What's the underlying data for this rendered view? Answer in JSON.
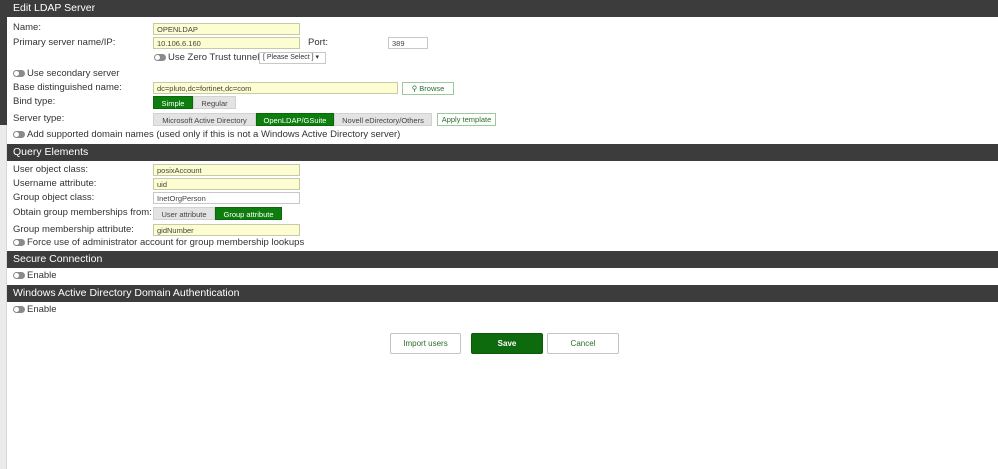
{
  "sections": {
    "edit": "Edit LDAP Server",
    "query": "Query Elements",
    "secure": "Secure Connection",
    "windows": "Windows Active Directory Domain Authentication"
  },
  "name": {
    "label": "Name:",
    "value": "OPENLDAP"
  },
  "primary_server": {
    "label": "Primary server name/IP:",
    "value": "10.106.6.160"
  },
  "port": {
    "label": "Port:",
    "value": "389"
  },
  "zero_trust": {
    "label": "Use Zero Trust tunnel",
    "select": "[ Please Select ]"
  },
  "secondary": {
    "label": "Use secondary server"
  },
  "base_dn": {
    "label": "Base distinguished name:",
    "value": "dc=pluto,dc=fortinet,dc=com",
    "browse": "Browse"
  },
  "bind_type": {
    "label": "Bind type:",
    "options": [
      "Simple",
      "Regular"
    ]
  },
  "server_type": {
    "label": "Server type:",
    "options": [
      "Microsoft Active Directory",
      "OpenLDAP/GSuite",
      "Novell eDirectory/Others"
    ],
    "apply": "Apply template"
  },
  "domain_names": {
    "label": "Add supported domain names (used only if this is not a Windows Active Directory server)"
  },
  "user_object_class": {
    "label": "User object class:",
    "value": "posixAccount"
  },
  "username_attr": {
    "label": "Username attribute:",
    "value": "uid"
  },
  "group_object_class": {
    "label": "Group object class:",
    "value": "InetOrgPerson"
  },
  "obtain_group": {
    "label": "Obtain group memberships from:",
    "options": [
      "User attribute",
      "Group attribute"
    ]
  },
  "group_membership_attr": {
    "label": "Group membership attribute:",
    "value": "gidNumber"
  },
  "force_admin": {
    "label": "Force use of administrator account for group membership lookups"
  },
  "secure_enable": {
    "label": "Enable"
  },
  "windows_enable": {
    "label": "Enable"
  },
  "buttons": {
    "import": "Import users",
    "save": "Save",
    "cancel": "Cancel"
  },
  "colors": {
    "header": "#3c3c3c",
    "accent": "#0d7d0d",
    "input_bg": "#fdfdd2"
  }
}
